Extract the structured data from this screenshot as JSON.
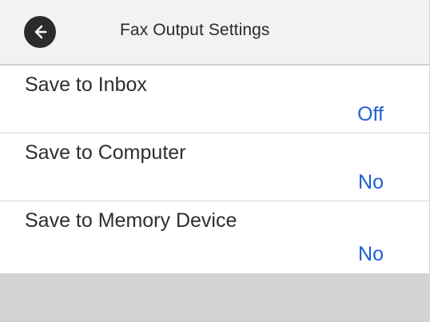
{
  "header": {
    "title": "Fax Output Settings",
    "back_icon": "arrow-left-icon"
  },
  "settings": [
    {
      "label": "Save to Inbox",
      "value": "Off"
    },
    {
      "label": "Save to Computer",
      "value": "No"
    },
    {
      "label": "Save to Memory Device",
      "value": "No"
    }
  ],
  "colors": {
    "value_text": "#1f5fd6",
    "header_bg": "#f2f2f2",
    "footer_bg": "#d3d3d3",
    "back_button": "#2b2b2b"
  }
}
